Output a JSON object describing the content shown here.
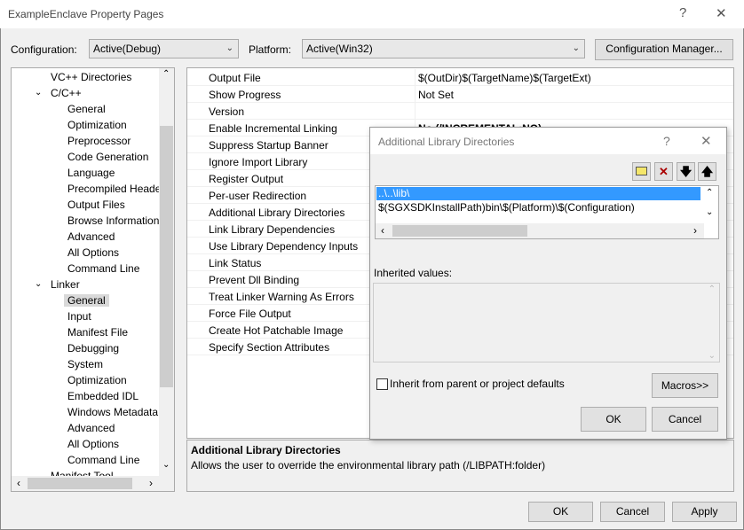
{
  "window": {
    "title": "ExampleEnclave Property Pages",
    "help": "?",
    "close": "✕"
  },
  "config": {
    "label": "Configuration:",
    "value": "Active(Debug)",
    "platform_label": "Platform:",
    "platform_value": "Active(Win32)",
    "manager": "Configuration Manager..."
  },
  "tree": {
    "items": [
      {
        "label": "VC++ Directories",
        "level": 1
      },
      {
        "label": "C/C++",
        "level": 1,
        "expanded": true
      },
      {
        "label": "General",
        "level": 2
      },
      {
        "label": "Optimization",
        "level": 2
      },
      {
        "label": "Preprocessor",
        "level": 2
      },
      {
        "label": "Code Generation",
        "level": 2
      },
      {
        "label": "Language",
        "level": 2
      },
      {
        "label": "Precompiled Heade",
        "level": 2
      },
      {
        "label": "Output Files",
        "level": 2
      },
      {
        "label": "Browse Information",
        "level": 2
      },
      {
        "label": "Advanced",
        "level": 2
      },
      {
        "label": "All Options",
        "level": 2
      },
      {
        "label": "Command Line",
        "level": 2
      },
      {
        "label": "Linker",
        "level": 1,
        "expanded": true
      },
      {
        "label": "General",
        "level": 2,
        "selected": true
      },
      {
        "label": "Input",
        "level": 2
      },
      {
        "label": "Manifest File",
        "level": 2
      },
      {
        "label": "Debugging",
        "level": 2
      },
      {
        "label": "System",
        "level": 2
      },
      {
        "label": "Optimization",
        "level": 2
      },
      {
        "label": "Embedded IDL",
        "level": 2
      },
      {
        "label": "Windows Metadata",
        "level": 2
      },
      {
        "label": "Advanced",
        "level": 2
      },
      {
        "label": "All Options",
        "level": 2
      },
      {
        "label": "Command Line",
        "level": 2
      },
      {
        "label": "Manifest Tool",
        "level": 1
      }
    ]
  },
  "grid": {
    "rows": [
      {
        "name": "Output File",
        "value": "$(OutDir)$(TargetName)$(TargetExt)"
      },
      {
        "name": "Show Progress",
        "value": "Not Set"
      },
      {
        "name": "Version",
        "value": ""
      },
      {
        "name": "Enable Incremental Linking",
        "value": "No (/INCREMENTAL:NO)",
        "bold": true
      },
      {
        "name": "Suppress Startup Banner",
        "value": ""
      },
      {
        "name": "Ignore Import Library",
        "value": ""
      },
      {
        "name": "Register Output",
        "value": ""
      },
      {
        "name": "Per-user Redirection",
        "value": ""
      },
      {
        "name": "Additional Library Directories",
        "value": ""
      },
      {
        "name": "Link Library Dependencies",
        "value": ""
      },
      {
        "name": "Use Library Dependency Inputs",
        "value": ""
      },
      {
        "name": "Link Status",
        "value": ""
      },
      {
        "name": "Prevent Dll Binding",
        "value": ""
      },
      {
        "name": "Treat Linker Warning As Errors",
        "value": ""
      },
      {
        "name": "Force File Output",
        "value": ""
      },
      {
        "name": "Create Hot Patchable Image",
        "value": ""
      },
      {
        "name": "Specify Section Attributes",
        "value": ""
      }
    ]
  },
  "description": {
    "title": "Additional Library Directories",
    "text": "Allows the user to override the environmental library path (/LIBPATH:folder)"
  },
  "buttons": {
    "ok": "OK",
    "cancel": "Cancel",
    "apply": "Apply"
  },
  "dialog": {
    "title": "Additional Library Directories",
    "help": "?",
    "close": "✕",
    "entries": [
      "..\\..\\lib\\",
      "$(SGXSDKInstallPath)bin\\$(Platform)\\$(Configuration)"
    ],
    "inherited_label": "Inherited values:",
    "inherit_checkbox": "Inherit from parent or project defaults",
    "inherit_checked": false,
    "macros": "Macros>>",
    "ok": "OK",
    "cancel": "Cancel",
    "selection_color": "#3399ff"
  }
}
